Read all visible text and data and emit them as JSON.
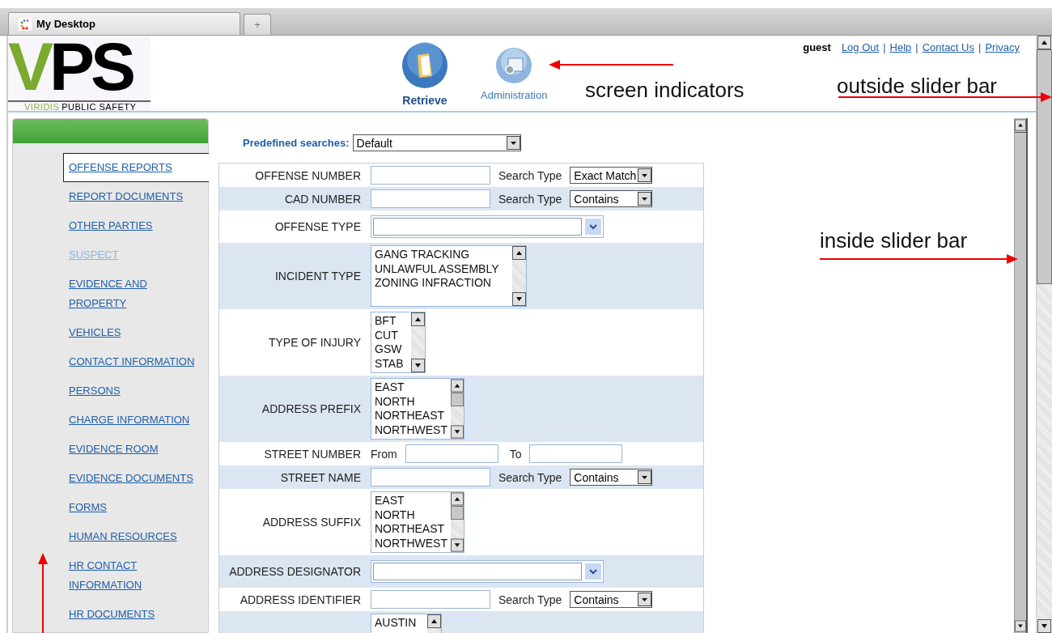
{
  "browser": {
    "tabs": [
      {
        "label": "My Desktop",
        "selected": true
      }
    ],
    "new_tab": "+"
  },
  "logo": {
    "mark_1": "V",
    "mark_2": "PS",
    "tagline_1": "VIRIDIS",
    "tagline_2": "PUBLIC SAFETY"
  },
  "nav": [
    {
      "label": "Retrieve",
      "kind": "folder",
      "selected": true
    },
    {
      "label": "Administration",
      "kind": "gear",
      "selected": false
    }
  ],
  "user": {
    "name": "guest",
    "links": [
      "Log Out",
      "Help",
      "Contact Us",
      "Privacy"
    ],
    "separator": "|"
  },
  "sidebar": {
    "items": [
      {
        "label": "OFFENSE REPORTS",
        "selected": true,
        "disabled": false
      },
      {
        "label": "REPORT DOCUMENTS",
        "selected": false,
        "disabled": false
      },
      {
        "label": "OTHER PARTIES",
        "selected": false,
        "disabled": false
      },
      {
        "label": "SUSPECT",
        "selected": false,
        "disabled": true
      },
      {
        "label": "EVIDENCE AND PROPERTY",
        "selected": false,
        "disabled": false
      },
      {
        "label": "VEHICLES",
        "selected": false,
        "disabled": false
      },
      {
        "label": "CONTACT INFORMATION",
        "selected": false,
        "disabled": false
      },
      {
        "label": "PERSONS",
        "selected": false,
        "disabled": false
      },
      {
        "label": "CHARGE INFORMATION",
        "selected": false,
        "disabled": false
      },
      {
        "label": "EVIDENCE ROOM",
        "selected": false,
        "disabled": false
      },
      {
        "label": "EVIDENCE DOCUMENTS",
        "selected": false,
        "disabled": false
      },
      {
        "label": "FORMS",
        "selected": false,
        "disabled": false
      },
      {
        "label": "HUMAN RESOURCES",
        "selected": false,
        "disabled": false
      },
      {
        "label": "HR CONTACT INFORMATION",
        "selected": false,
        "disabled": false
      },
      {
        "label": "HR DOCUMENTS",
        "selected": false,
        "disabled": false
      }
    ]
  },
  "predefined": {
    "label": "Predefined searches:",
    "value": "Default"
  },
  "form": [
    {
      "kind": "text",
      "label": "OFFENSE NUMBER",
      "search_label": "Search Type",
      "search_value": "Exact Match"
    },
    {
      "kind": "text",
      "label": "CAD NUMBER",
      "search_label": "Search Type",
      "search_value": "Contains"
    },
    {
      "kind": "combo",
      "label": "OFFENSE TYPE"
    },
    {
      "kind": "list",
      "label": "INCIDENT TYPE",
      "options": [
        "GANG TRACKING",
        "UNLAWFUL ASSEMBLY",
        "ZONING INFRACTION"
      ]
    },
    {
      "kind": "list",
      "label": "TYPE OF INJURY",
      "options": [
        "BFT",
        "CUT",
        "GSW",
        "STAB"
      ]
    },
    {
      "kind": "list",
      "label": "ADDRESS PREFIX",
      "options": [
        "EAST",
        "NORTH",
        "NORTHEAST",
        "NORTHWEST"
      ]
    },
    {
      "kind": "range",
      "label": "STREET NUMBER",
      "from_label": "From",
      "to_label": "To"
    },
    {
      "kind": "text",
      "label": "STREET NAME",
      "search_label": "Search Type",
      "search_value": "Contains"
    },
    {
      "kind": "list",
      "label": "ADDRESS SUFFIX",
      "options": [
        "EAST",
        "NORTH",
        "NORTHEAST",
        "NORTHWEST"
      ]
    },
    {
      "kind": "combo",
      "label": "ADDRESS DESIGNATOR"
    },
    {
      "kind": "text",
      "label": "ADDRESS IDENTIFIER",
      "search_label": "Search Type",
      "search_value": "Contains"
    },
    {
      "kind": "list",
      "options": [
        "AUSTIN"
      ]
    }
  ],
  "annotations": [
    {
      "kind": "left",
      "text": "screen indicators"
    },
    {
      "kind": "right",
      "text": "outside slider bar"
    },
    {
      "kind": "right",
      "text": "inside slider bar"
    },
    {
      "kind": "up"
    }
  ]
}
